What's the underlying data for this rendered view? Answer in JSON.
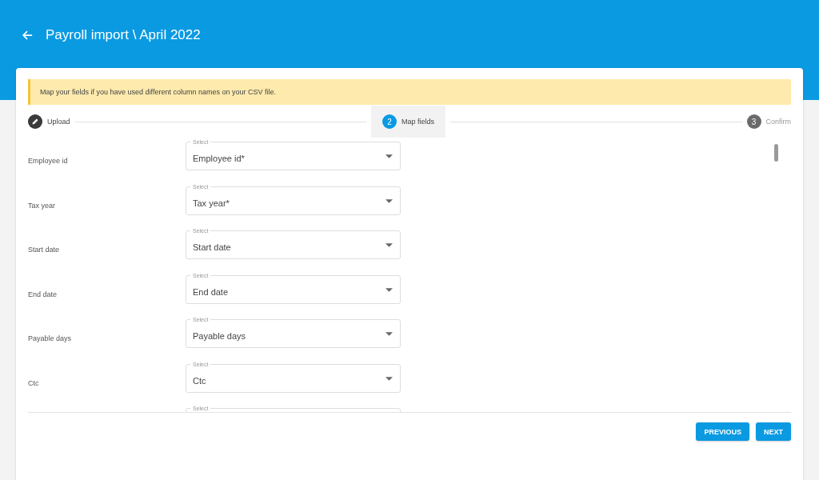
{
  "header": {
    "title": "Payroll import \\ April 2022"
  },
  "notice": "Map your fields if you have used different column names on your CSV file.",
  "steps": [
    {
      "label": "Upload",
      "completed": true,
      "selected": false
    },
    {
      "number": "2",
      "label": "Map fields",
      "completed": false,
      "selected": true
    },
    {
      "number": "3",
      "label": "Confirm",
      "completed": false,
      "selected": false
    }
  ],
  "rows": [
    {
      "label": "Employee id",
      "field_label": "Select",
      "value": "Employee id*"
    },
    {
      "label": "Tax year",
      "field_label": "Select",
      "value": "Tax year*"
    },
    {
      "label": "Start date",
      "field_label": "Select",
      "value": "Start date"
    },
    {
      "label": "End date",
      "field_label": "Select",
      "value": "End date"
    },
    {
      "label": "Payable days",
      "field_label": "Select",
      "value": "Payable days"
    },
    {
      "label": "Ctc",
      "field_label": "Select",
      "value": "Ctc"
    },
    {
      "field_label": "Select"
    }
  ],
  "buttons": [
    "PREVIOUS",
    "NEXT"
  ]
}
